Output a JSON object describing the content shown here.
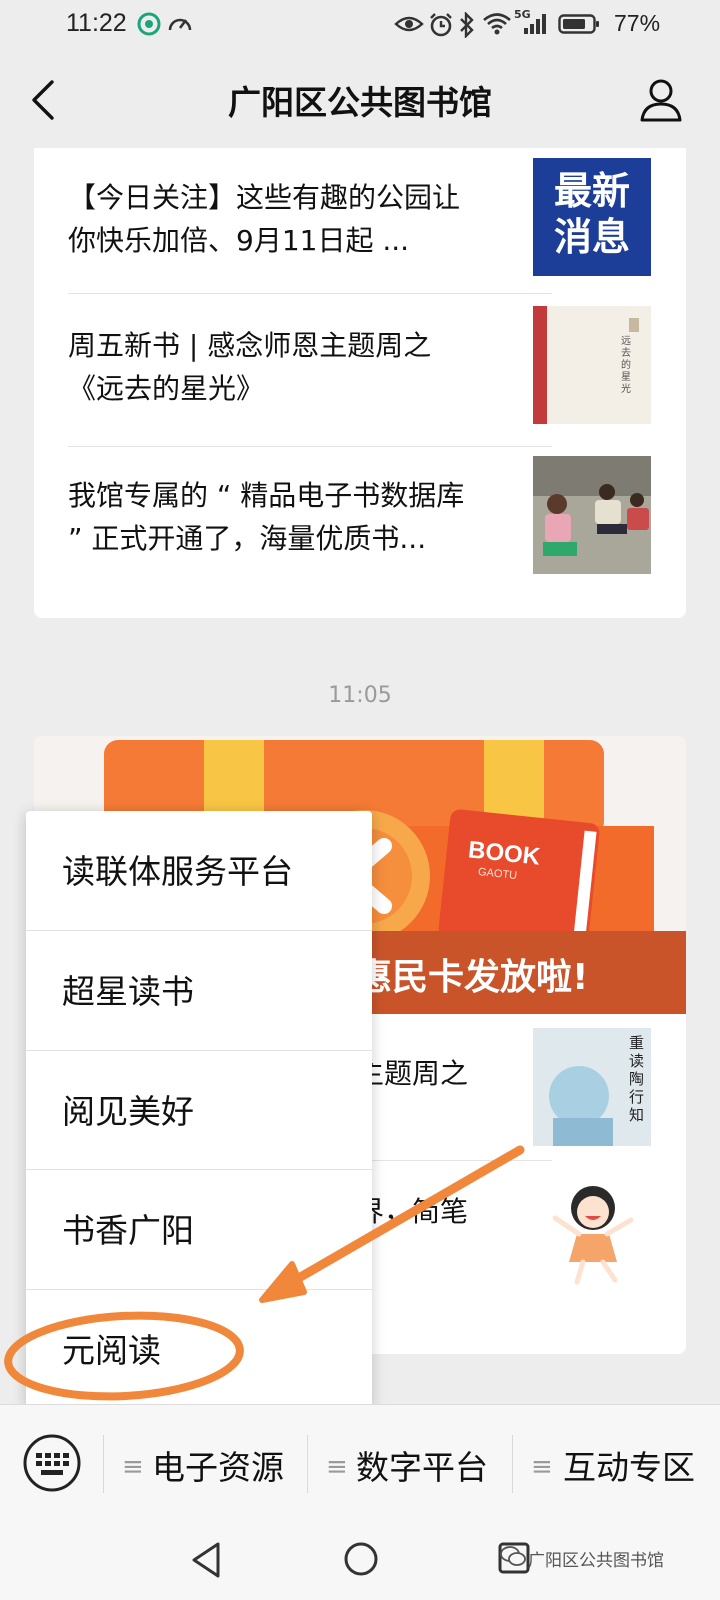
{
  "status_bar": {
    "time": "11:22",
    "network": "5G",
    "battery": "77%"
  },
  "nav": {
    "title": "广阳区公共图书馆"
  },
  "articles_top": [
    {
      "title_line1": "【今日关注】这些有趣的公园让",
      "title_line2": "你快乐加倍、9月11日起 ...",
      "thumb_line1": "最新",
      "thumb_line2": "消息"
    },
    {
      "title_line1": "周五新书 | 感念师恩主题周之",
      "title_line2": "《远去的星光》",
      "thumb_text": "远去的星光"
    },
    {
      "title_line1": "我馆专属的 “ 精品电子书数据库",
      "title_line2": "” 正式开通了，海量优质书..."
    }
  ],
  "timestamp": "11:05",
  "banner": {
    "book_label": "BOOK",
    "book_sub": "GAOTU",
    "caption": "惠民卡发放啦!"
  },
  "articles_bottom": [
    {
      "visible_text": "主题周之",
      "thumb_text": "重读陶行知"
    },
    {
      "visible_text": "界，简笔"
    }
  ],
  "popup_menu": {
    "items": [
      "读联体服务平台",
      "超星读书",
      "阅见美好",
      "书香广阳",
      "元阅读"
    ]
  },
  "bottom_menu": {
    "tabs": [
      "电子资源",
      "数字平台",
      "互动专区"
    ]
  },
  "watermark": "广阳区公共图书馆",
  "colors": {
    "background": "#ededed",
    "highlight": "#f0873a",
    "text": "#111111"
  }
}
